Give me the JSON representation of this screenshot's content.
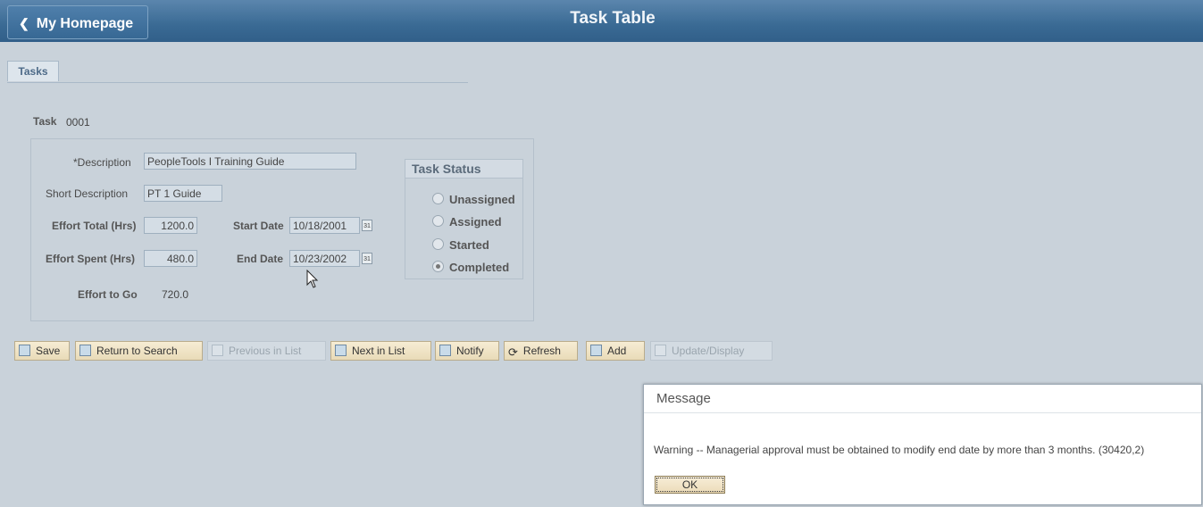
{
  "header": {
    "back_label": "My Homepage",
    "title": "Task Table"
  },
  "tabs": [
    {
      "label": "Tasks"
    }
  ],
  "task": {
    "label": "Task",
    "value": "0001"
  },
  "form": {
    "description": {
      "label": "*Description",
      "value": "PeopleTools I Training Guide"
    },
    "short_description": {
      "label": "Short Description",
      "value": "PT 1 Guide"
    },
    "effort_total": {
      "label": "Effort Total (Hrs)",
      "value": "1200.0"
    },
    "effort_spent": {
      "label": "Effort Spent (Hrs)",
      "value": "480.0"
    },
    "effort_to_go": {
      "label": "Effort to Go",
      "value": "720.0"
    },
    "start_date": {
      "label": "Start Date",
      "value": "10/18/2001"
    },
    "end_date": {
      "label": "End Date",
      "value": "10/23/2002"
    },
    "calendar_glyph": "31"
  },
  "task_status": {
    "title": "Task Status",
    "options": [
      {
        "label": "Unassigned",
        "selected": false
      },
      {
        "label": "Assigned",
        "selected": false
      },
      {
        "label": "Started",
        "selected": false
      },
      {
        "label": "Completed",
        "selected": true
      }
    ]
  },
  "toolbar": {
    "save": "Save",
    "return_to_search": "Return to Search",
    "previous_in_list": "Previous in List",
    "next_in_list": "Next in List",
    "notify": "Notify",
    "refresh": "Refresh",
    "add": "Add",
    "update_display": "Update/Display"
  },
  "message": {
    "title": "Message",
    "text": "Warning -- Managerial approval must be obtained to modify end date by more than 3 months. (30420,2)",
    "ok_label": "OK"
  }
}
